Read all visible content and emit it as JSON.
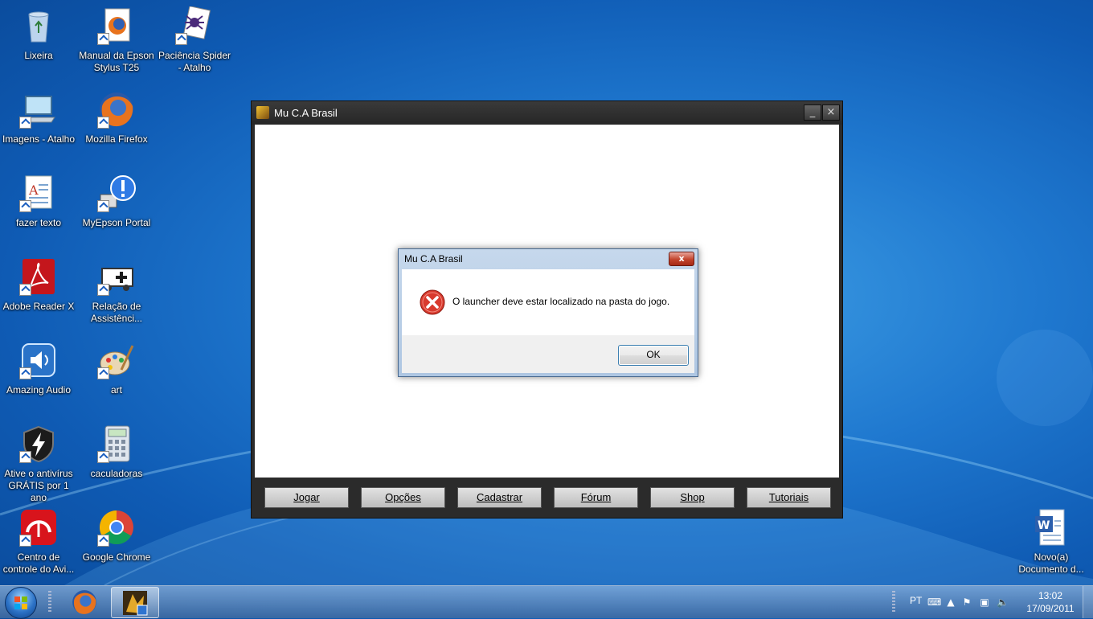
{
  "desktop": {
    "icons": [
      {
        "label": "Lixeira"
      },
      {
        "label": "Manual da Epson Stylus T25"
      },
      {
        "label": "Paciência Spider - Atalho"
      },
      {
        "label": "Imagens - Atalho"
      },
      {
        "label": "Mozilla Firefox"
      },
      {
        "label": "fazer texto"
      },
      {
        "label": "MyEpson Portal"
      },
      {
        "label": "Adobe Reader X"
      },
      {
        "label": "Relação de Assistênci..."
      },
      {
        "label": "Amazing Audio"
      },
      {
        "label": "art"
      },
      {
        "label": "Ative o antivírus GRÁTIS por 1 ano"
      },
      {
        "label": "caculadoras"
      },
      {
        "label": "Centro de controle do Avi..."
      },
      {
        "label": "Google Chrome"
      },
      {
        "label": "Novo(a) Documento d..."
      }
    ]
  },
  "launcher": {
    "title": "Mu C.A Brasil",
    "minimize": "_",
    "close": "×",
    "buttons": [
      "Jogar",
      "Opções",
      "Cadastrar",
      "Fórum",
      "Shop",
      "Tutoriais"
    ]
  },
  "dialog": {
    "title": "Mu C.A Brasil",
    "close": "x",
    "message": "O launcher deve estar localizado na pasta do jogo.",
    "ok": "OK"
  },
  "taskbar": {
    "language": "PT",
    "time": "13:02",
    "date": "17/09/2011"
  }
}
